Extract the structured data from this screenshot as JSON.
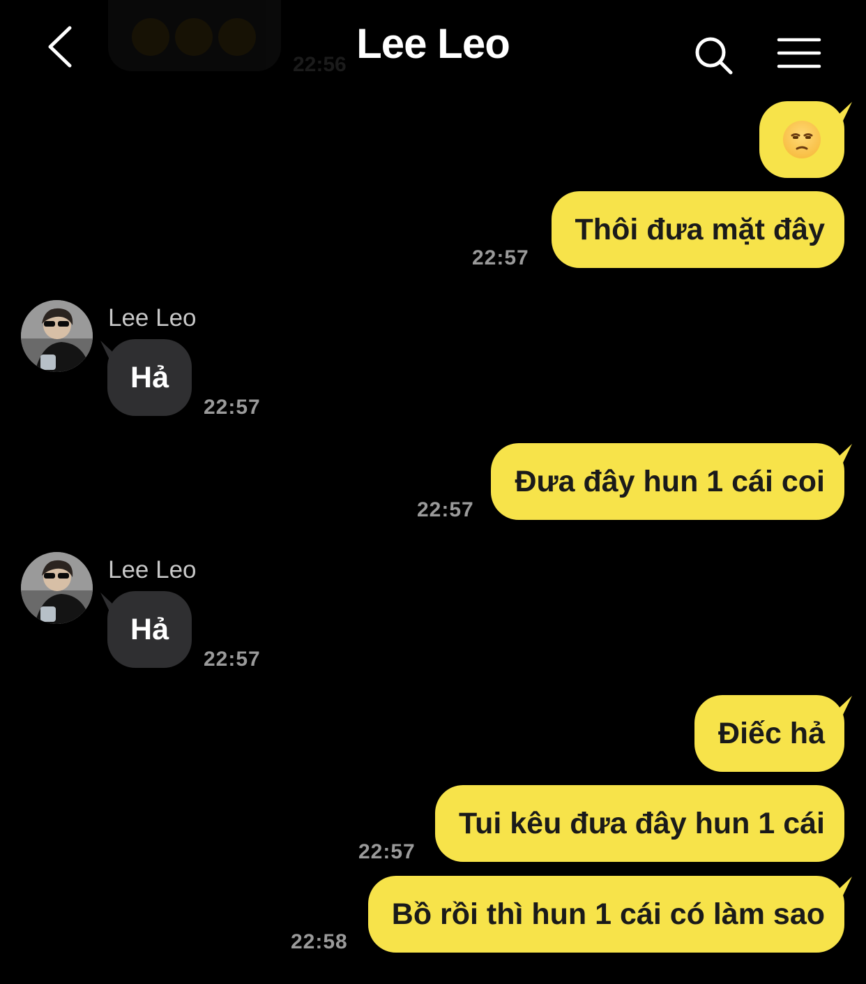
{
  "header": {
    "title": "Lee Leo",
    "back_icon": "chevron-left-icon",
    "search_icon": "search-icon",
    "menu_icon": "hamburger-menu-icon",
    "ghost_time": "22:56"
  },
  "colors": {
    "background": "#000000",
    "outgoing_bubble": "#f7e34a",
    "incoming_bubble": "#2f2f31",
    "timestamp": "#9a9a9a"
  },
  "messages": [
    {
      "direction": "out",
      "type": "emoji",
      "emoji": "unamused-face-icon"
    },
    {
      "direction": "out",
      "text": "Thôi đưa mặt đây",
      "time": "22:57"
    },
    {
      "direction": "in",
      "sender": "Lee Leo",
      "text": "Hả",
      "time": "22:57"
    },
    {
      "direction": "out",
      "text": "Đưa đây hun 1 cái coi",
      "time": "22:57"
    },
    {
      "direction": "in",
      "sender": "Lee Leo",
      "text": "Hả",
      "time": "22:57"
    },
    {
      "direction": "out",
      "text": "Điếc hả"
    },
    {
      "direction": "out",
      "text": "Tui kêu đưa đây hun 1 cái",
      "time": "22:57"
    },
    {
      "direction": "out",
      "text": "Bồ rồi thì hun 1 cái có làm sao",
      "time": "22:58"
    }
  ]
}
